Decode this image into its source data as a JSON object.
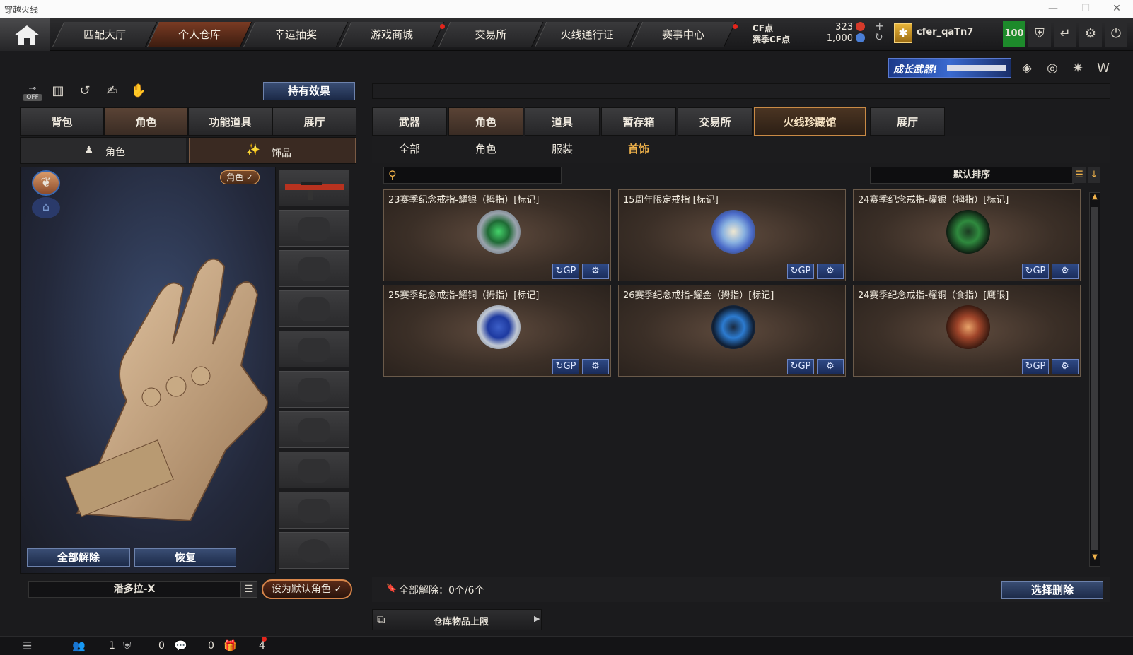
{
  "window": {
    "title": "穿越火线",
    "minimize": "—",
    "maximize": "☐",
    "close": "✕"
  },
  "topnav": {
    "tabs": [
      {
        "label": "匹配大厅"
      },
      {
        "label": "个人仓库"
      },
      {
        "label": "幸运抽奖"
      },
      {
        "label": "游戏商城"
      },
      {
        "label": "交易所"
      },
      {
        "label": "火线通行证"
      },
      {
        "label": "赛事中心"
      }
    ],
    "currency": {
      "cf_label": "CF点",
      "cf_value": "323",
      "match_label": "赛季CF点",
      "match_value": "1,000"
    },
    "username": "cfer_qaTn7",
    "level": "100"
  },
  "banner": {
    "text": "成长武器!"
  },
  "left": {
    "off_label": "OFF",
    "effect_button": "持有效果",
    "tabs": [
      "背包",
      "角色",
      "功能道具",
      "展厅"
    ],
    "subtabs": [
      "角色",
      "饰品"
    ],
    "role_badge": "角色 ✓",
    "unequip_all": "全部解除",
    "restore": "恢复",
    "character_name": "潘多拉-X",
    "set_default": "设为默认角色 ✓"
  },
  "right": {
    "tabs": [
      "武器",
      "角色",
      "道具",
      "暂存箱",
      "交易所",
      "火线珍藏馆",
      "展厅"
    ],
    "subtabs": [
      "全部",
      "角色",
      "服装",
      "首饰"
    ],
    "search_placeholder": "",
    "sort_label": "默认排序",
    "items": [
      {
        "name": "23赛季纪念戒指-耀银（拇指）[标记]",
        "color": "#2f8a3e"
      },
      {
        "name": "15周年限定戒指 [标记]",
        "color": "#5a8ac8"
      },
      {
        "name": "24赛季纪念戒指-耀银（拇指）[标记]",
        "color": "#1f6a35"
      },
      {
        "name": "25赛季纪念戒指-耀铜（拇指）[标记]",
        "color": "#3c5fc8"
      },
      {
        "name": "26赛季纪念戒指-耀金（拇指）[标记]",
        "color": "#2c7bd0"
      },
      {
        "name": "24赛季纪念戒指-耀铜（食指）[鹰眼]",
        "color": "#a0452a"
      }
    ],
    "card_buttons": {
      "gp": "↻GP",
      "settings": "⚙"
    },
    "unequip_status": "全部解除：0个/6个",
    "delete_button": "选择删除",
    "storage_limit": "仓库物品上限"
  },
  "bottombar": {
    "count1": "1",
    "count2": "0",
    "count3": "0",
    "count4": "4"
  }
}
